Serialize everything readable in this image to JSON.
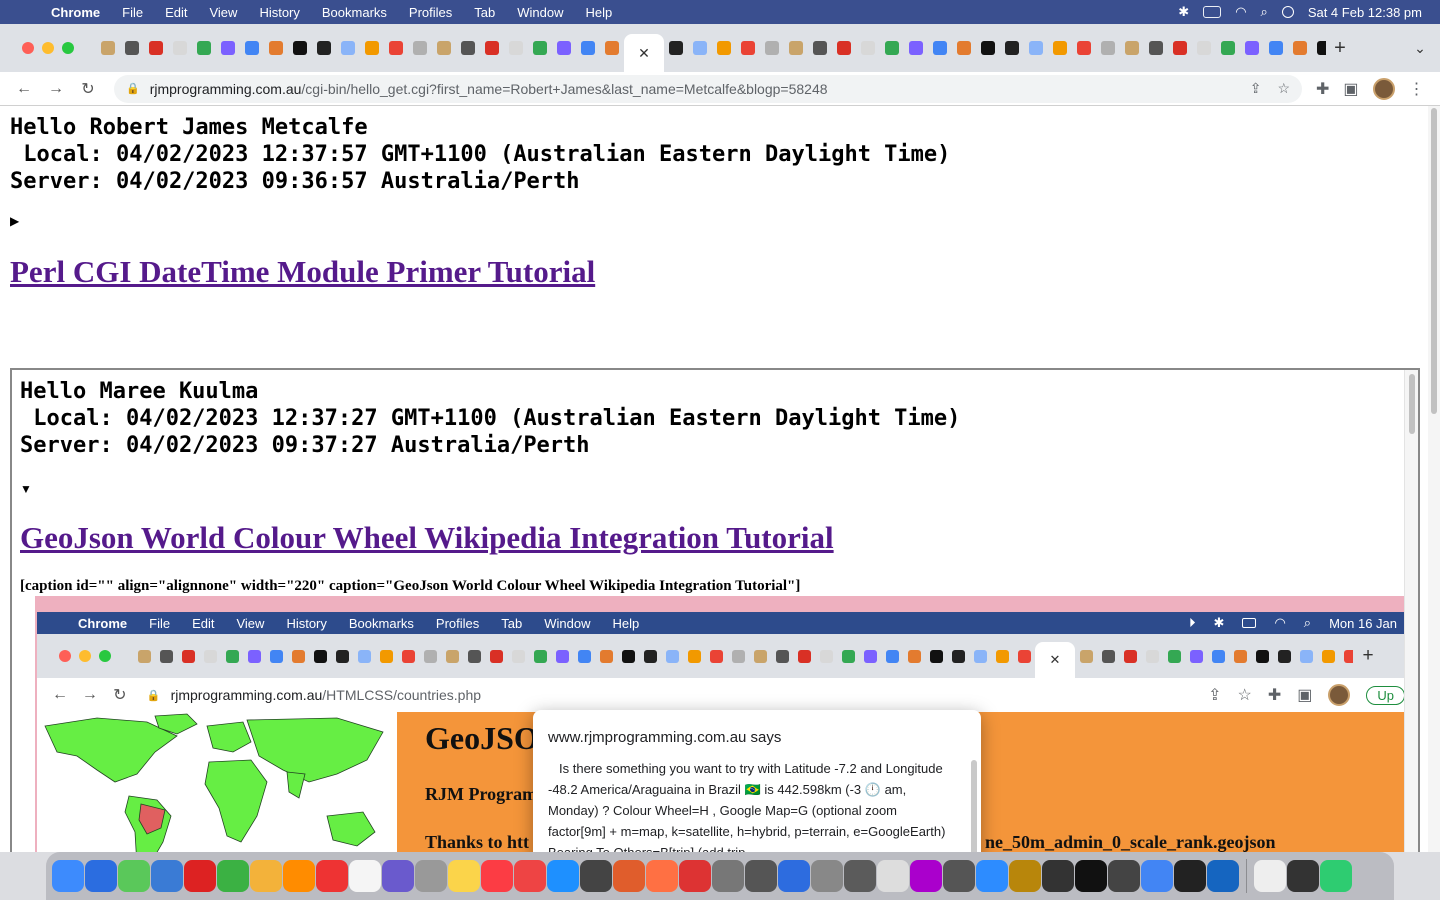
{
  "mac_menubar": {
    "app_name": "Chrome",
    "items": [
      "File",
      "Edit",
      "View",
      "History",
      "Bookmarks",
      "Profiles",
      "Tab",
      "Window",
      "Help"
    ],
    "datetime": "Sat 4 Feb  12:38 pm"
  },
  "browser": {
    "url_host": "rjmprogramming.com.au",
    "url_path": "/cgi-bin/hello_get.cgi?first_name=Robert+James&last_name=Metcalfe&blogp=58248",
    "tab_count_visible": 52
  },
  "page": {
    "greeting": "Hello Robert James Metcalfe",
    "local_time": " Local: 04/02/2023 12:37:57 GMT+1100 (Australian Eastern Daylight Time)",
    "server_time": "Server: 04/02/2023 09:36:57 Australia/Perth",
    "disclosure_symbol": "▶",
    "title_link": "Perl CGI DateTime Module Primer Tutorial"
  },
  "iframe": {
    "greeting": "Hello Maree Kuulma",
    "local_time": " Local: 04/02/2023 12:37:27 GMT+1100 (Australian Eastern Daylight Time)",
    "server_time": "Server: 04/02/2023 09:37:27 Australia/Perth",
    "disclosure_symbol": "▼",
    "title_link": "GeoJson World Colour Wheel Wikipedia Integration Tutorial",
    "caption": "[caption id=\"\" align=\"alignnone\" width=\"220\" caption=\"GeoJson World Colour Wheel Wikipedia Integration Tutorial\"]"
  },
  "embedded_screenshot": {
    "menubar_app": "Chrome",
    "menubar_items": [
      "File",
      "Edit",
      "View",
      "History",
      "Bookmarks",
      "Profiles",
      "Tab",
      "Window",
      "Help"
    ],
    "datetime": "Mon 16 Jan",
    "url_host": "rjmprogramming.com.au",
    "url_path": "/HTMLCSS/countries.php",
    "update_label": "Up",
    "page_heading": "GeoJSO",
    "rjm_text": "RJM Program",
    "thanks_text": "Thanks to htt",
    "geojson_file_text": "ne_50m_admin_0_scale_rank.geojson",
    "dialog_title": "www.rjmprogramming.com.au says",
    "dialog_body": "Is there something you want to try with Latitude -7.2 and Longitude -48.2 America/Araguaina in Brazil 🇧🇷 is 442.598km (-3 🕛 am, Monday) ? Colour Wheel=H , Google Map=G (optional zoom factor[9m] + m=map, k=satellite, h=hybrid, p=terrain, e=GoogleEarth) Bearing To Others=B[trip] (add trip"
  },
  "colors": {
    "menubar_bg": "#3a4f8f",
    "link_visited": "#551a8b",
    "screenshot_frame": "#eeb0bf",
    "geo_orange": "#f4953a",
    "map_land": "#66ee44"
  }
}
